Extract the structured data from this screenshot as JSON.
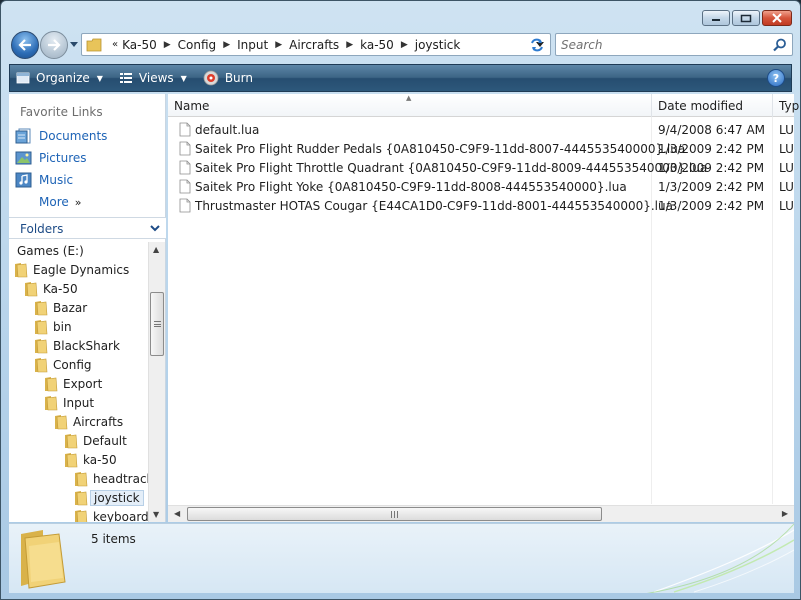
{
  "window": {
    "caption_buttons": [
      "minimize",
      "maximize",
      "close"
    ]
  },
  "navigation": {
    "breadcrumb": [
      "Ka-50",
      "Config",
      "Input",
      "Aircrafts",
      "ka-50",
      "joystick"
    ],
    "overflow_marker": "«",
    "search_placeholder": "Search"
  },
  "commandbar": {
    "organize": "Organize",
    "views": "Views",
    "burn": "Burn",
    "help": "?"
  },
  "favorites": {
    "title": "Favorite Links",
    "items": [
      {
        "label": "Documents",
        "icon": "documents-icon"
      },
      {
        "label": "Pictures",
        "icon": "pictures-icon"
      },
      {
        "label": "Music",
        "icon": "music-icon"
      }
    ],
    "more": "More"
  },
  "folders": {
    "title": "Folders",
    "tree": [
      {
        "label": "Games (E:)",
        "level": 0,
        "icon": "none"
      },
      {
        "label": "Eagle Dynamics",
        "level": 0,
        "icon": "folder"
      },
      {
        "label": "Ka-50",
        "level": 1,
        "icon": "folder"
      },
      {
        "label": "Bazar",
        "level": 2,
        "icon": "folder"
      },
      {
        "label": "bin",
        "level": 2,
        "icon": "folder"
      },
      {
        "label": "BlackShark",
        "level": 2,
        "icon": "folder"
      },
      {
        "label": "Config",
        "level": 2,
        "icon": "folder"
      },
      {
        "label": "Export",
        "level": 3,
        "icon": "folder"
      },
      {
        "label": "Input",
        "level": 3,
        "icon": "folder"
      },
      {
        "label": "Aircrafts",
        "level": 4,
        "icon": "folder"
      },
      {
        "label": "Default",
        "level": 5,
        "icon": "folder"
      },
      {
        "label": "ka-50",
        "level": 5,
        "icon": "folder"
      },
      {
        "label": "headtracker",
        "level": 6,
        "icon": "folder"
      },
      {
        "label": "joystick",
        "level": 6,
        "icon": "folder",
        "selected": true
      },
      {
        "label": "keyboard",
        "level": 6,
        "icon": "folder"
      }
    ]
  },
  "filelist": {
    "columns": [
      "Name",
      "Date modified",
      "Typ"
    ],
    "files": [
      {
        "name": "default.lua",
        "date": "9/4/2008 6:47 AM",
        "type": "LU"
      },
      {
        "name": "Saitek Pro Flight Rudder Pedals {0A810450-C9F9-11dd-8007-444553540000}.lua",
        "date": "1/3/2009 2:42 PM",
        "type": "LU"
      },
      {
        "name": "Saitek Pro Flight Throttle Quadrant {0A810450-C9F9-11dd-8009-444553540000}.lua",
        "date": "1/3/2009 2:42 PM",
        "type": "LU"
      },
      {
        "name": "Saitek Pro Flight Yoke {0A810450-C9F9-11dd-8008-444553540000}.lua",
        "date": "1/3/2009 2:42 PM",
        "type": "LU"
      },
      {
        "name": "Thrustmaster HOTAS Cougar {E44CA1D0-C9F9-11dd-8001-444553540000}.lua",
        "date": "1/3/2009 2:42 PM",
        "type": "LU"
      }
    ]
  },
  "details": {
    "count": "5 items"
  },
  "colors": {
    "accent_link": "#1d63b6",
    "commandbar": "#2d587b",
    "folder_yellow": "#e8c45a"
  }
}
